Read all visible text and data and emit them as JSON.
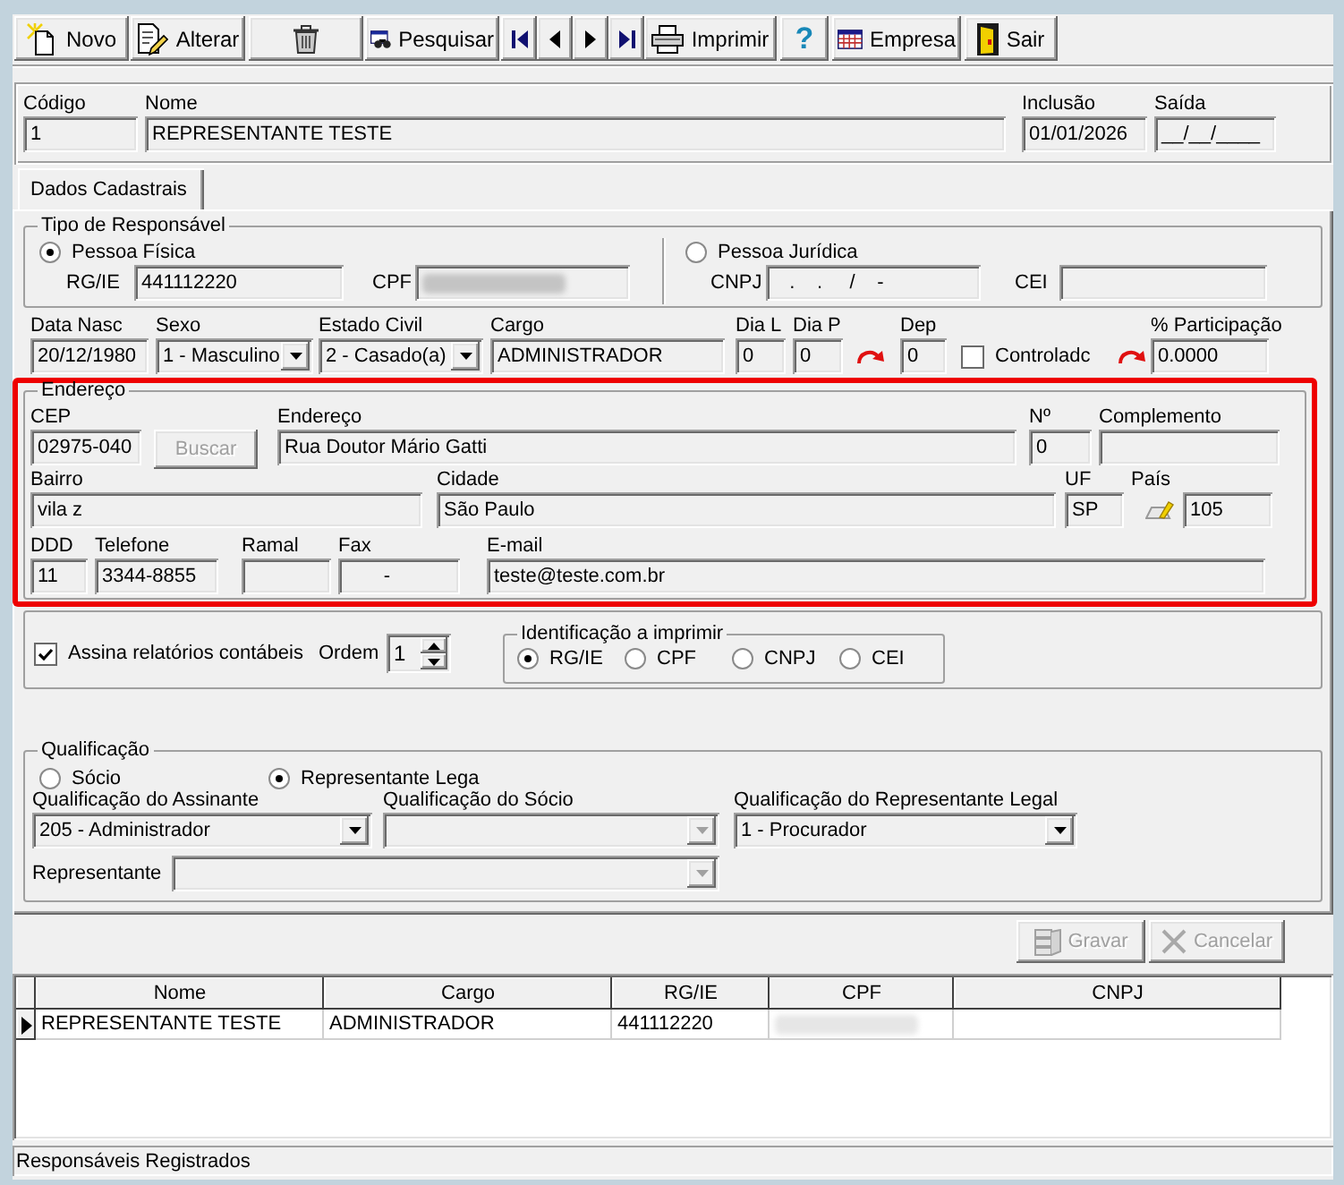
{
  "toolbar": {
    "buttons": [
      {
        "kind": "new",
        "label": "Novo"
      },
      {
        "kind": "edit",
        "label": "Alterar"
      },
      {
        "kind": "delete"
      },
      {
        "kind": "search",
        "label": "Pesquisar"
      },
      {
        "kind": "first"
      },
      {
        "kind": "previous"
      },
      {
        "kind": "next"
      },
      {
        "kind": "last"
      },
      {
        "kind": "print",
        "label": "Imprimir"
      },
      {
        "kind": "help",
        "label": "?"
      },
      {
        "kind": "company",
        "label": "Empresa"
      },
      {
        "kind": "exit",
        "label": "Sair"
      }
    ]
  },
  "header": {
    "fields": [
      {
        "label": "Código",
        "value": "1"
      },
      {
        "label": "Nome",
        "value": "REPRESENTANTE TESTE"
      },
      {
        "label": "Inclusão",
        "value": "01/01/2026"
      },
      {
        "label": "Saída",
        "value": "__/__/____"
      }
    ]
  },
  "tabs": [
    {
      "label": "Dados Cadastrais",
      "selected": true
    }
  ],
  "responsible_type": {
    "title": "Tipo de Responsável",
    "options": [
      {
        "label": "Pessoa Física",
        "selected": true,
        "fields": [
          {
            "label": "RG/IE",
            "value": "441112220"
          },
          {
            "label": "CPF",
            "blurred": true
          }
        ]
      },
      {
        "label": "Pessoa Jurídica",
        "selected": false,
        "fields": [
          {
            "label": "CNPJ",
            "value": "   .    .     /    -"
          },
          {
            "label": "CEI"
          }
        ]
      }
    ]
  },
  "personal": {
    "items": [
      {
        "kind": "text",
        "label": "Data Nasc",
        "value": "20/12/1980"
      },
      {
        "kind": "combo",
        "label": "Sexo",
        "value": "1 - Masculino"
      },
      {
        "kind": "combo",
        "label": "Estado Civil",
        "value": "2 - Casado(a)"
      },
      {
        "kind": "text",
        "label": "Cargo",
        "value": "ADMINISTRADOR"
      },
      {
        "kind": "text",
        "label": "Dia L",
        "value": "0"
      },
      {
        "kind": "text",
        "label": "Dia P",
        "value": "0"
      },
      {
        "kind": "arrow"
      },
      {
        "kind": "text",
        "label": "Dep",
        "value": "0"
      },
      {
        "kind": "checkbox",
        "label": "Controladc",
        "checked": false
      },
      {
        "kind": "arrow"
      },
      {
        "kind": "text",
        "label": "% Participação",
        "value": "0.0000"
      }
    ]
  },
  "address": {
    "title": "Endereço",
    "highlighted": true,
    "rows": [
      [
        {
          "kind": "text",
          "label": "CEP",
          "value": "02975-040"
        },
        {
          "kind": "button",
          "label": "Buscar",
          "disabled": true
        },
        {
          "kind": "text",
          "label": "Endereço",
          "value": "Rua Doutor Mário Gatti"
        },
        {
          "kind": "text",
          "label": "Nº",
          "value": "0"
        },
        {
          "kind": "text",
          "label": "Complemento"
        }
      ],
      [
        {
          "kind": "text",
          "label": "Bairro",
          "value": "vila z"
        },
        {
          "kind": "text",
          "label": "Cidade",
          "value": "São Paulo"
        },
        {
          "kind": "text",
          "label": "UF",
          "value": "SP"
        },
        {
          "kind": "lookup",
          "label": "País",
          "value": "105"
        }
      ],
      [
        {
          "kind": "text",
          "label": "DDD",
          "value": "11"
        },
        {
          "kind": "text",
          "label": "Telefone",
          "value": "3344-8855"
        },
        {
          "kind": "text",
          "label": "Ramal"
        },
        {
          "kind": "text",
          "label": "Fax",
          "value": "       -"
        },
        {
          "kind": "text",
          "label": "E-mail",
          "value": "teste@teste.com.br"
        }
      ]
    ]
  },
  "signing": {
    "checkbox": {
      "label": "Assina relatórios contábeis",
      "checked": true
    },
    "order": {
      "label": "Ordem",
      "value": "1"
    },
    "print_identification": {
      "title": "Identificação a imprimir",
      "options": [
        {
          "label": "RG/IE",
          "selected": true
        },
        {
          "label": "CPF",
          "selected": false
        },
        {
          "label": "CNPJ",
          "selected": false
        },
        {
          "label": "CEI",
          "selected": false
        }
      ]
    }
  },
  "qualification": {
    "title": "Qualificação",
    "options": [
      {
        "label": "Sócio",
        "selected": false
      },
      {
        "label": "Representante Lega",
        "selected": true
      }
    ],
    "combos": [
      {
        "label": "Qualificação do Assinante",
        "value": "205 - Administrador",
        "disabled": false
      },
      {
        "label": "Qualificação do Sócio",
        "disabled": true
      },
      {
        "label": "Qualificação do Representante Legal",
        "value": "1 - Procurador",
        "disabled": false
      }
    ],
    "representative": {
      "label": "Representante",
      "disabled": true
    }
  },
  "actions": [
    {
      "kind": "save",
      "label": "Gravar",
      "disabled": true
    },
    {
      "kind": "cancel",
      "label": "Cancelar",
      "disabled": true
    }
  ],
  "grid": {
    "columns": [
      "Nome",
      "Cargo",
      "RG/IE",
      "CPF",
      "CNPJ"
    ],
    "rows": [
      {
        "selected": true,
        "cells": [
          {
            "text": "REPRESENTANTE TESTE"
          },
          {
            "text": "ADMINISTRADOR"
          },
          {
            "text": "441112220"
          },
          {
            "blurred": true
          }
        ]
      }
    ]
  },
  "status_bar": {
    "text": "Responsáveis Registrados"
  }
}
